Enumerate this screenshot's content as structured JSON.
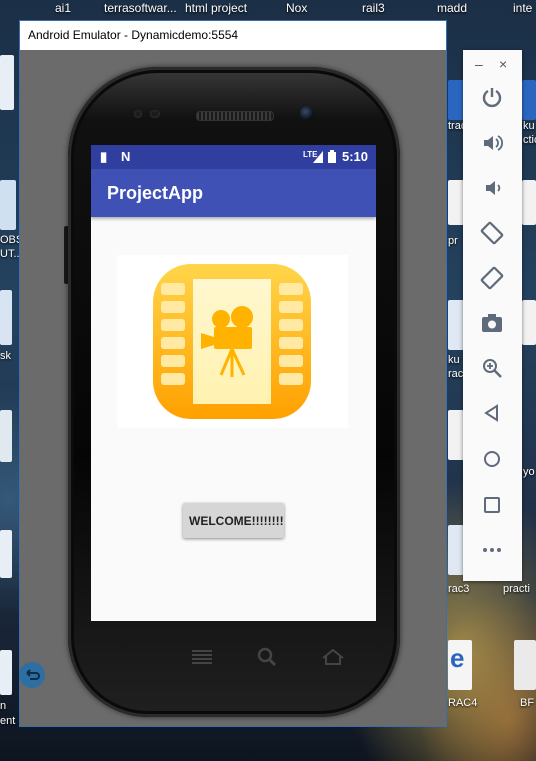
{
  "desktop": {
    "top_labels": [
      "ai1",
      "terrasoftwar...",
      "html project",
      "Nox",
      "rail3",
      "madd",
      "inte"
    ],
    "left_labels": [
      "OBS",
      "UT...",
      "sk",
      "n",
      "ent"
    ],
    "right_labels": [
      "trac",
      "ku",
      "ctic",
      "pr",
      "ku",
      "rac",
      "yo",
      "rac3",
      "practi",
      "RAC4",
      "BF"
    ]
  },
  "window": {
    "title": "Android Emulator - Dynamicdemo:5554"
  },
  "phone": {
    "status": {
      "time": "5:10",
      "network": "LTE"
    },
    "app_title": "ProjectApp",
    "welcome_button": "WELCOME!!!!!!!!",
    "image_icon": "film-camera-icon"
  },
  "toolbar": {
    "buttons": [
      "power-icon",
      "volume-up-icon",
      "volume-down-icon",
      "rotate-left-icon",
      "rotate-right-icon",
      "screenshot-icon",
      "zoom-icon",
      "back-icon",
      "home-icon",
      "overview-icon",
      "more-icon"
    ]
  },
  "colors": {
    "status_bar": "#303f9f",
    "app_bar": "#3f51b5",
    "icon_yellow": "#ffc107",
    "toolbar_icon": "#5f6b7a"
  }
}
